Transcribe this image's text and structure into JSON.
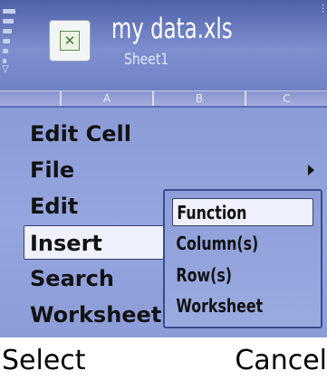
{
  "title_bar": {
    "file_name": "my data.xls",
    "sheet_name": "Sheet1",
    "app_icon": "excel-document-icon"
  },
  "column_header": {
    "columns": [
      "A",
      "B",
      "C"
    ]
  },
  "menu": {
    "items": [
      {
        "label": "Edit Cell",
        "has_submenu": false,
        "selected": false
      },
      {
        "label": "File",
        "has_submenu": true,
        "selected": false
      },
      {
        "label": "Edit",
        "has_submenu": false,
        "selected": false
      },
      {
        "label": "Insert",
        "has_submenu": true,
        "selected": true
      },
      {
        "label": "Search",
        "has_submenu": false,
        "selected": false
      },
      {
        "label": "Worksheet",
        "has_submenu": false,
        "selected": false
      }
    ]
  },
  "submenu": {
    "items": [
      {
        "label": "Function",
        "selected": true
      },
      {
        "label": "Column(s)",
        "selected": false
      },
      {
        "label": "Row(s)",
        "selected": false
      },
      {
        "label": "Worksheet",
        "selected": false
      }
    ]
  },
  "softkeys": {
    "left": "Select",
    "right": "Cancel"
  },
  "colors": {
    "title_bar": "#6f82c6",
    "menu_background": "#8c9cd7",
    "selection_fill": "#eef0fb"
  }
}
